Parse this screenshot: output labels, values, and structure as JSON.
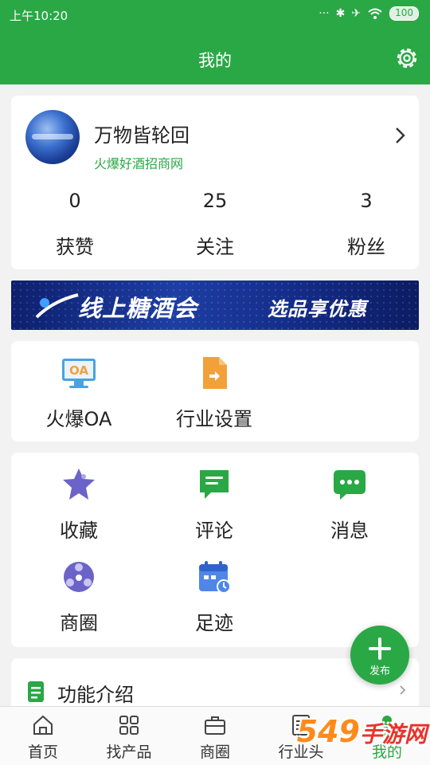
{
  "status_bar": {
    "time": "上午10:20",
    "battery": "100"
  },
  "header": {
    "title": "我的"
  },
  "profile": {
    "name": "万物皆轮回",
    "subtitle": "火爆好酒招商网",
    "stats": [
      {
        "value": "0",
        "label": "获赞"
      },
      {
        "value": "25",
        "label": "关注"
      },
      {
        "value": "3",
        "label": "粉丝"
      }
    ]
  },
  "banner": {
    "text_main": "线上糖酒会",
    "text_sub": "选品享优惠"
  },
  "tools": [
    {
      "label": "火爆OA",
      "icon": "oa-monitor-icon",
      "icon_text": "OA"
    },
    {
      "label": "行业设置",
      "icon": "industry-doc-icon"
    }
  ],
  "features_grid": [
    {
      "label": "收藏",
      "icon": "star-icon"
    },
    {
      "label": "评论",
      "icon": "comment-icon"
    },
    {
      "label": "消息",
      "icon": "message-icon"
    },
    {
      "label": "商圈",
      "icon": "circle-icon"
    },
    {
      "label": "足迹",
      "icon": "calendar-icon"
    }
  ],
  "feature_intro": {
    "label": "功能介绍"
  },
  "fab": {
    "label": "发布"
  },
  "tab_bar": [
    {
      "label": "首页",
      "icon": "home-icon"
    },
    {
      "label": "找产品",
      "icon": "grid-icon"
    },
    {
      "label": "商圈",
      "icon": "briefcase-icon"
    },
    {
      "label": "行业头",
      "icon": "news-icon"
    },
    {
      "label": "我的",
      "icon": "person-icon",
      "active": true
    }
  ],
  "watermark": {
    "main": "549",
    "tail": "手游网"
  },
  "colors": {
    "brand_green": "#2aa845",
    "star_purple": "#6b63c8",
    "calendar_blue": "#4f86e8",
    "doc_orange": "#f2a13a"
  }
}
